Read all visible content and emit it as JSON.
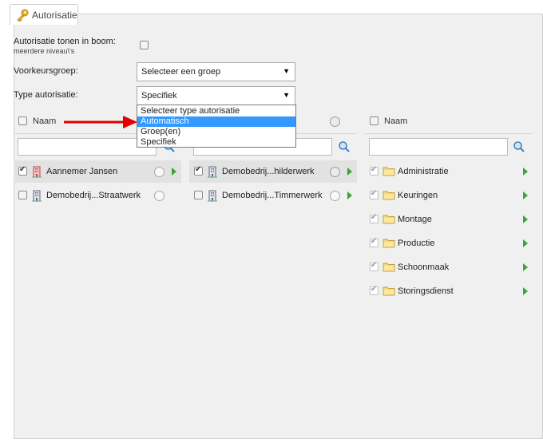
{
  "tab": {
    "label": "Autorisatie",
    "icon": "key-icon"
  },
  "form": {
    "tree_label": "Autorisatie tonen in boom:",
    "tree_sublabel": "meerdere niveau\\'s",
    "pref_group_label": "Voorkeursgroep:",
    "pref_group_value": "Selecteer een groep",
    "auth_type_label": "Type autorisatie:",
    "auth_type_value": "Specifiek"
  },
  "dropdown_options": [
    "Selecteer type autorisatie",
    "Automatisch",
    "Groep(en)",
    "Specifiek"
  ],
  "dropdown_selected": "Automatisch",
  "columns": {
    "col1_header": "Naam",
    "col3_header": "Naam",
    "col1_rows": [
      {
        "label": "Aannemer Jansen",
        "checked": true
      },
      {
        "label": "Demobedrij...Straatwerk",
        "checked": false
      }
    ],
    "col2_rows": [
      {
        "label": "Demobedrij...hilderwerk",
        "checked": true
      },
      {
        "label": "Demobedrij...Timmerwerk",
        "checked": false
      }
    ],
    "col3_rows": [
      {
        "label": "Administratie"
      },
      {
        "label": "Keuringen"
      },
      {
        "label": "Montage"
      },
      {
        "label": "Productie"
      },
      {
        "label": "Schoonmaak"
      },
      {
        "label": "Storingsdienst"
      }
    ]
  },
  "colors": {
    "selection": "#3399ff",
    "arrow": "#e00000",
    "play": "#3aa63a",
    "panel_bg": "#f0f0f0"
  }
}
